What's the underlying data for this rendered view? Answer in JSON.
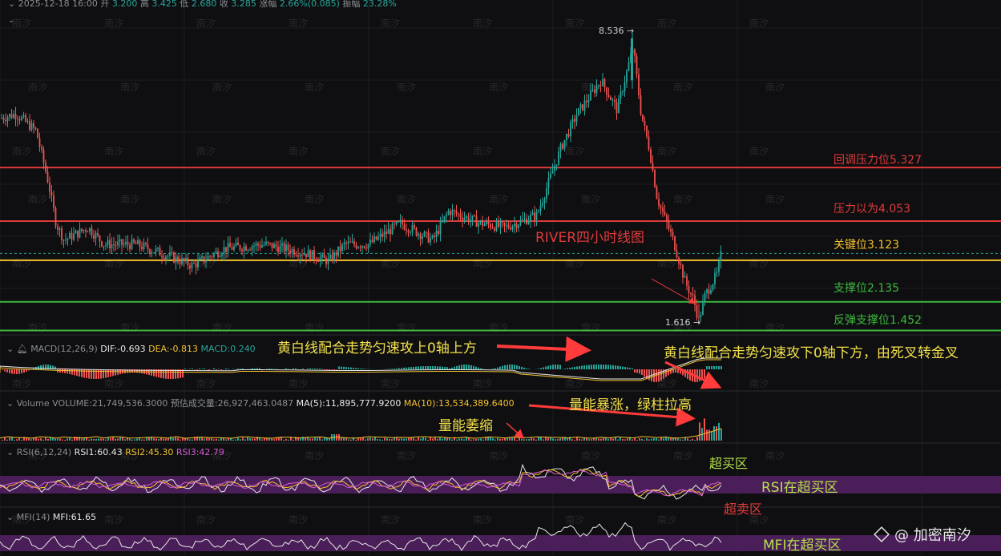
{
  "header": {
    "date": "2025-12-18 16:00",
    "open_label": "开",
    "open": "3.200",
    "high_label": "高",
    "high": "3.425",
    "low_label": "低",
    "low": "2.680",
    "close_label": "收",
    "close": "3.285",
    "change_label": "涨幅",
    "change": "2.66%(0.085)",
    "amplitude_label": "振幅",
    "amplitude": "23.28%"
  },
  "watermark": "南汐",
  "brand": {
    "icon": "binance-square-icon",
    "text": "@ 加密南汐"
  },
  "price_levels": [
    {
      "label": "回调压力位5.327",
      "color": "#e03a3a"
    },
    {
      "label": "压力以为4.053",
      "color": "#e03a3a"
    },
    {
      "label": "关键位3.123",
      "color": "#f2c12e"
    },
    {
      "label": "支撑位2.135",
      "color": "#3cb83c"
    },
    {
      "label": "反弹支撑位1.452",
      "color": "#3cb83c"
    }
  ],
  "chart_title": "RIVER四小时线图",
  "max_label": "8.536",
  "min_label": "1.616",
  "macd": {
    "name": "MACD(12,26,9)",
    "dif": "DIF:-0.693",
    "dea": "DEA:-0.813",
    "macd": "MACD:0.240"
  },
  "volume": {
    "name": "Volume",
    "vol": "VOLUME:21,749,536.3000",
    "est": "预估成交量:26,927,463.0487",
    "ma5": "MA(5):11,895,777.9200",
    "ma10": "MA(10):13,534,389.6400"
  },
  "rsi": {
    "name": "RSI(6,12,24)",
    "rsi1": "RSI1:60.43",
    "rsi2": "RSI2:45.30",
    "rsi3": "RSI3:42.79"
  },
  "mfi": {
    "name": "MFI(14)",
    "mfi": "MFI:61.65"
  },
  "annotations": {
    "macd_up": "黄白线配合走势匀速攻上0轴上方",
    "macd_down": "黄白线配合走势匀速攻下0轴下方，由死叉转金叉",
    "vol_surge": "量能暴涨，绿柱拉高",
    "vol_shrink": "量能萎缩",
    "overbought": "超买区",
    "rsi_overbought": "RSI在超买区",
    "oversold": "超卖区",
    "mfi_overbought": "MFI在超买区"
  },
  "colors": {
    "up": "#26a69a",
    "down": "#ef5350",
    "accent_red": "#e03a3a",
    "accent_yellow": "#f2c12e",
    "accent_green": "#3cb83c"
  },
  "chart_data": {
    "type": "candlestick",
    "levels": [
      5.327,
      4.053,
      3.123,
      2.135,
      1.452
    ],
    "high_marker": 8.536,
    "low_marker": 1.616,
    "last_close": 3.285,
    "price_path": [
      [
        0,
        6.5
      ],
      [
        20,
        6.6
      ],
      [
        45,
        6.2
      ],
      [
        60,
        5.0
      ],
      [
        70,
        4.0
      ],
      [
        80,
        3.6
      ],
      [
        110,
        3.9
      ],
      [
        130,
        3.5
      ],
      [
        170,
        3.5
      ],
      [
        200,
        3.3
      ],
      [
        240,
        3.0
      ],
      [
        280,
        3.4
      ],
      [
        330,
        3.5
      ],
      [
        380,
        3.3
      ],
      [
        410,
        3.1
      ],
      [
        430,
        3.5
      ],
      [
        460,
        3.5
      ],
      [
        500,
        4.0
      ],
      [
        540,
        3.6
      ],
      [
        560,
        4.3
      ],
      [
        600,
        4.0
      ],
      [
        630,
        3.9
      ],
      [
        670,
        4.2
      ],
      [
        700,
        5.8
      ],
      [
        720,
        6.6
      ],
      [
        750,
        7.4
      ],
      [
        770,
        6.7
      ],
      [
        790,
        8.2
      ],
      [
        800,
        6.6
      ],
      [
        810,
        5.8
      ],
      [
        820,
        4.6
      ],
      [
        840,
        3.6
      ],
      [
        855,
        2.6
      ],
      [
        865,
        2.2
      ],
      [
        872,
        1.7
      ],
      [
        880,
        2.3
      ],
      [
        895,
        2.8
      ],
      [
        900,
        3.285
      ]
    ]
  }
}
